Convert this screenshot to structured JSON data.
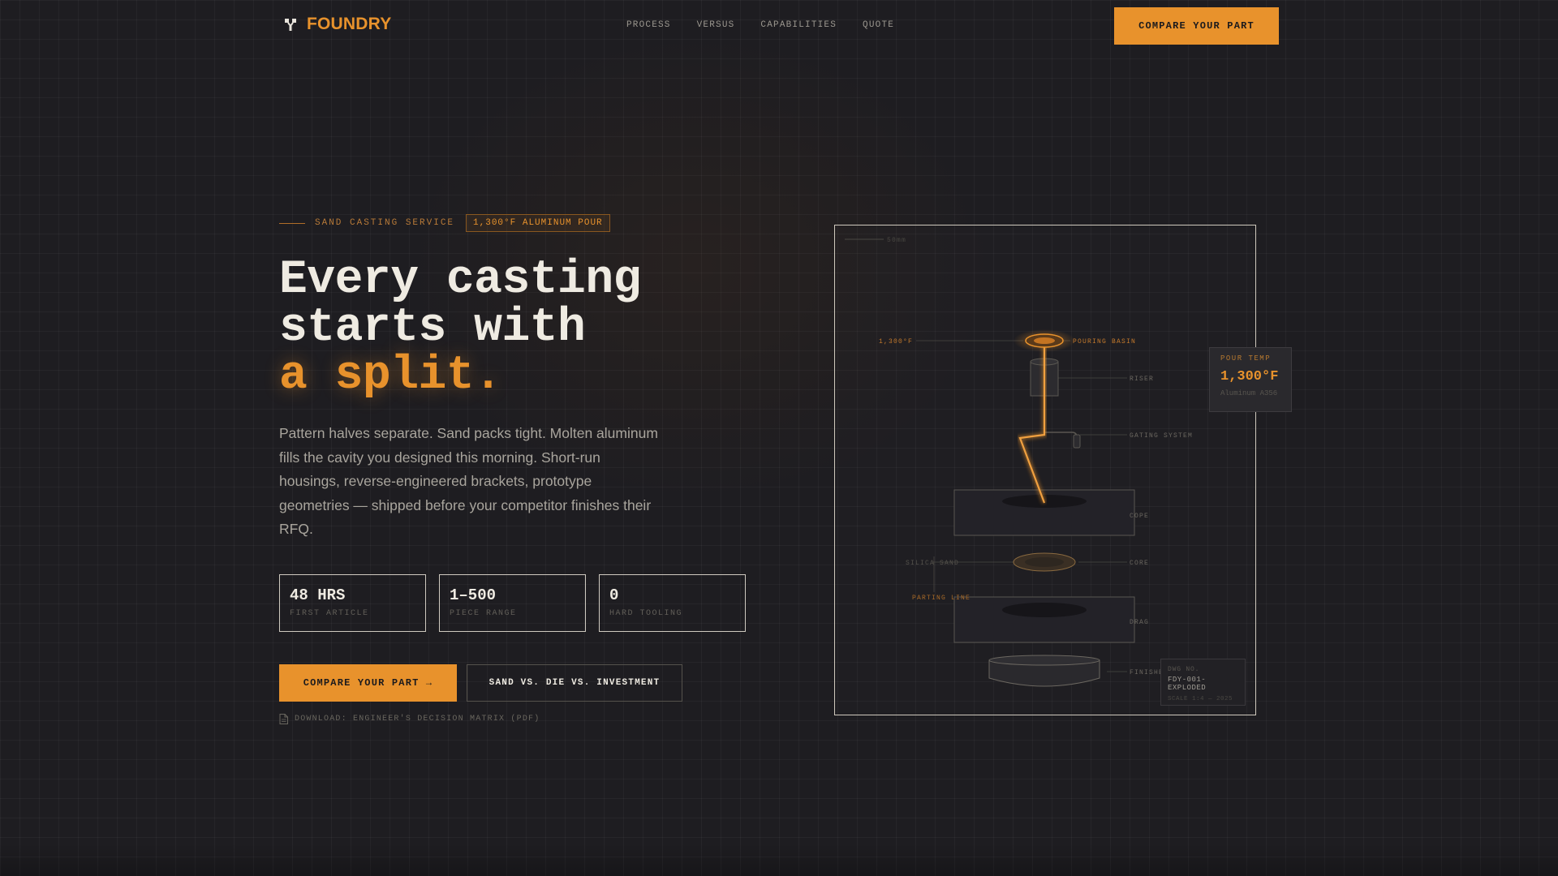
{
  "nav": {
    "brand": "FOUNDRY",
    "links": [
      "PROCESS",
      "VERSUS",
      "CAPABILITIES",
      "QUOTE"
    ],
    "cta": "COMPARE YOUR PART"
  },
  "hero": {
    "eyebrow": "SAND CASTING SERVICE",
    "badge": "1,300°F ALUMINUM POUR",
    "headline": [
      "Every casting",
      "starts with",
      "a split."
    ],
    "lede": "Pattern halves separate. Sand packs tight. Molten aluminum fills the cavity you designed this morning. Short-run housings, reverse-engineered brackets, prototype geometries — shipped before your competitor finishes their RFQ.",
    "stats": [
      {
        "value": "48 HRS",
        "label": "FIRST ARTICLE"
      },
      {
        "value": "1–500",
        "label": "PIECE RANGE"
      },
      {
        "value": "0",
        "label": "HARD TOOLING"
      }
    ],
    "cta_primary": "COMPARE YOUR PART →",
    "cta_secondary": "SAND VS. DIE VS. INVESTMENT",
    "download": "DOWNLOAD: ENGINEER'S DECISION MATRIX (PDF)"
  },
  "diagram": {
    "scale_note": "50mm",
    "temp_label": "1,300°F",
    "labels": {
      "pouring_basin": "POURING BASIN",
      "riser": "RISER",
      "gating_system": "GATING SYSTEM",
      "cope": "COPE",
      "silica_sand": "SILICA SAND",
      "core": "CORE",
      "parting_line": "PARTING LINE",
      "drag": "DRAG",
      "finished": "FINISHED"
    },
    "pour_card": {
      "label": "POUR TEMP",
      "value": "1,300°F",
      "sub": "Aluminum A356"
    },
    "drawing": {
      "line1": "DWG NO.",
      "line2": "FDY-001-EXPLODED",
      "line3": "SCALE 1:4 — 2025"
    }
  },
  "colors": {
    "accent": "#e8922c",
    "background": "#1e1d21",
    "text": "#efebe2",
    "muted": "#a9a59d"
  }
}
